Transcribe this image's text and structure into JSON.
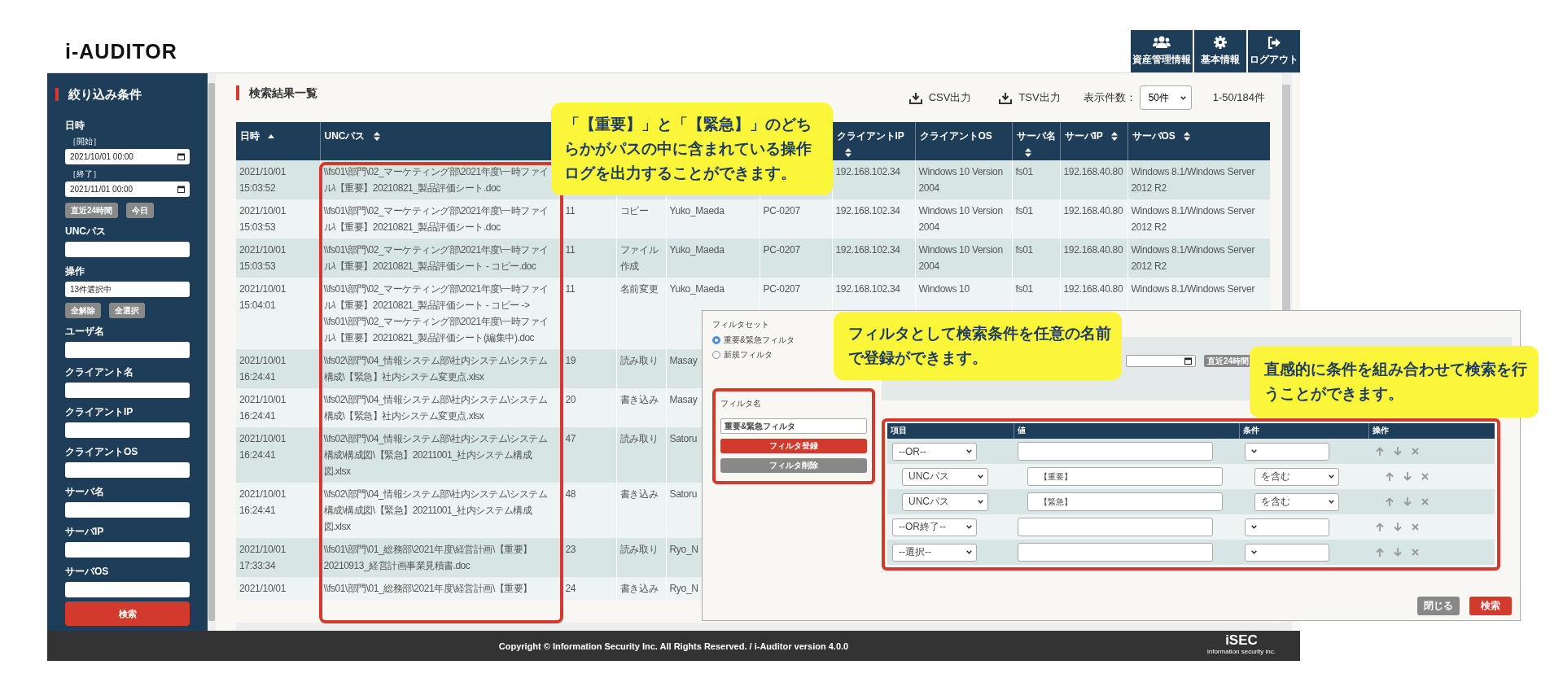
{
  "header": {
    "logo": "i-AUDITOR",
    "nav": [
      {
        "label": "資産管理情報",
        "kind": "users"
      },
      {
        "label": "基本情報",
        "kind": "gear"
      },
      {
        "label": "ログアウト",
        "kind": "logout"
      }
    ]
  },
  "sidebar": {
    "title": "絞り込み条件",
    "items": [
      {
        "kind": "label",
        "text": "日時"
      },
      {
        "kind": "sublabel",
        "text": "［開始］"
      },
      {
        "kind": "date",
        "value": "2021/10/01 00:00"
      },
      {
        "kind": "sublabel",
        "text": "［終了］"
      },
      {
        "kind": "date",
        "value": "2021/11/01 00:00"
      },
      {
        "kind": "buttons",
        "buttons": [
          "直近24時間",
          "今日"
        ]
      },
      {
        "kind": "label",
        "text": "UNCパス"
      },
      {
        "kind": "input"
      },
      {
        "kind": "label",
        "text": "操作"
      },
      {
        "kind": "input",
        "value": "13件選択中"
      },
      {
        "kind": "buttons",
        "buttons": [
          "全解除",
          "全選択"
        ]
      },
      {
        "kind": "label",
        "text": "ユーザ名"
      },
      {
        "kind": "input"
      },
      {
        "kind": "label",
        "text": "クライアント名"
      },
      {
        "kind": "input"
      },
      {
        "kind": "label",
        "text": "クライアントIP"
      },
      {
        "kind": "input"
      },
      {
        "kind": "label",
        "text": "クライアントOS"
      },
      {
        "kind": "input"
      },
      {
        "kind": "label",
        "text": "サーバ名"
      },
      {
        "kind": "input"
      },
      {
        "kind": "label",
        "text": "サーバIP"
      },
      {
        "kind": "input"
      },
      {
        "kind": "label",
        "text": "サーバOS"
      },
      {
        "kind": "input"
      }
    ],
    "search_button": "検索"
  },
  "results": {
    "title": "検索結果一覧",
    "exports": [
      "CSV出力",
      "TSV出力"
    ],
    "page_size_label": "表示件数：",
    "page_size": "50件",
    "range": "1-50/184件",
    "table": {
      "columns": [
        {
          "label": "日時",
          "kind": "sortable",
          "sorted": true
        },
        {
          "label": "UNCパス",
          "kind": "sortable",
          "sorted": false
        },
        null,
        null,
        null,
        null,
        {
          "label": "クライアントIP",
          "kind": "sortable",
          "sorted": false
        },
        {
          "label": "クライアントOS",
          "kind": "plain"
        },
        {
          "label": "サーバ名",
          "kind": "sortable",
          "sorted": false
        },
        {
          "label": "サーバIP",
          "kind": "sortable",
          "sorted": false
        },
        {
          "label": "サーバOS",
          "kind": "sortable",
          "sorted": false
        }
      ],
      "rows": [
        {
          "cells": [
            "2021/10/01 15:03:52",
            "\\\\fs01\\部門\\02_マーケティング部\\2021年度\\一時ファイル\\【重要】20210821_製品評価シート.doc",
            null,
            null,
            null,
            null,
            "192.168.102.34",
            "Windows 10 Version 2004",
            "fs01",
            "192.168.40.80",
            "Windows 8.1/Windows Server 2012 R2"
          ]
        },
        {
          "cells": [
            "2021/10/01 15:03:53",
            "\\\\fs01\\部門\\02_マーケティング部\\2021年度\\一時ファイル\\【重要】20210821_製品評価シート.doc",
            "11",
            "コピー",
            "Yuko_Maeda",
            "PC-0207",
            "192.168.102.34",
            "Windows 10 Version 2004",
            "fs01",
            "192.168.40.80",
            "Windows 8.1/Windows Server 2012 R2"
          ]
        },
        {
          "cells": [
            "2021/10/01 15:03:53",
            "\\\\fs01\\部門\\02_マーケティング部\\2021年度\\一時ファイル\\【重要】20210821_製品評価シート - コピー.doc",
            "11",
            "ファイル作成",
            "Yuko_Maeda",
            "PC-0207",
            "192.168.102.34",
            "Windows 10 Version 2004",
            "fs01",
            "192.168.40.80",
            "Windows 8.1/Windows Server 2012 R2"
          ]
        },
        {
          "cells": [
            "2021/10/01 15:04:01",
            "\\\\fs01\\部門\\02_マーケティング部\\2021年度\\一時ファイル\\【重要】20210821_製品評価シート - コピー -> \\\\fs01\\部門\\02_マーケティング部\\2021年度\\一時ファイル\\【重要】20210821_製品評価シート(編集中).doc",
            "11",
            "名前変更",
            "Yuko_Maeda",
            "PC-0207",
            "192.168.102.34",
            "Windows 10",
            "fs01",
            "192.168.40.80",
            "Windows 8.1/Windows Server"
          ]
        },
        {
          "cells": [
            "2021/10/01 16:24:41",
            "\\\\fs02\\部門\\04_情報システム部\\社内システム\\システム構成\\【緊急】社内システム変更点.xlsx",
            "19",
            "読み取り",
            "Masay",
            null,
            null,
            null,
            null,
            null,
            null
          ]
        },
        {
          "cells": [
            "2021/10/01 16:24:41",
            "\\\\fs02\\部門\\04_情報システム部\\社内システム\\システム構成\\【緊急】社内システム変更点.xlsx",
            "20",
            "書き込み",
            "Masay",
            null,
            null,
            null,
            null,
            null,
            null
          ]
        },
        {
          "cells": [
            "2021/10/01 16:24:41",
            "\\\\fs02\\部門\\04_情報システム部\\社内システム\\システム構成\\構成図\\【緊急】20211001_社内システム構成図.xlsx",
            "47",
            "読み取り",
            "Satoru",
            null,
            null,
            null,
            null,
            null,
            null
          ]
        },
        {
          "cells": [
            "2021/10/01 16:24:41",
            "\\\\fs02\\部門\\04_情報システム部\\社内システム\\システム構成\\構成図\\【緊急】20211001_社内システム構成図.xlsx",
            "48",
            "書き込み",
            "Satoru",
            null,
            null,
            null,
            null,
            null,
            null
          ]
        },
        {
          "cells": [
            "2021/10/01 17:33:34",
            "\\\\fs01\\部門\\01_総務部\\2021年度\\経営計画\\【重要】20210913_経営計画事業見積書.doc",
            "23",
            "読み取り",
            "Ryo_N",
            null,
            null,
            null,
            null,
            null,
            null
          ]
        },
        {
          "cells": [
            "2021/10/01",
            "\\\\fs01\\部門\\01_総務部\\2021年度\\経営計画\\【重要】",
            "24",
            "書き込み",
            "Ryo_N",
            null,
            null,
            null,
            null,
            null,
            null
          ]
        }
      ]
    }
  },
  "modal": {
    "filter_set_label": "フィルタセット",
    "filter_sets": [
      {
        "label": "重要&緊急フィルタ",
        "selected": true
      },
      {
        "label": "新規フィルタ",
        "selected": false
      }
    ],
    "filter_name_label": "フィルタ名",
    "filter_name": "重要&緊急フィルタ",
    "register_button": "フィルタ登録",
    "delete_button": "フィルタ削除",
    "quick_button": "直近24時間",
    "conditions": {
      "columns": [
        "項目",
        "値",
        "条件",
        "操作"
      ],
      "rows": [
        {
          "item": "--OR--",
          "children": [
            {
              "item": "UNCパス",
              "value": "【重要】",
              "condition": "を含む"
            },
            {
              "item": "UNCパス",
              "value": "【緊急】",
              "condition": "を含む"
            }
          ]
        },
        {
          "item": "--OR終了--"
        },
        {
          "item": "--選択--"
        }
      ]
    },
    "buttons": [
      {
        "label": "閉じる",
        "kind": "secondary"
      },
      {
        "label": "検索",
        "kind": "primary"
      }
    ]
  },
  "callouts": [
    {
      "text": "「【重要】」と「【緊急】」のどちらかがパスの中に含まれている操作ログを出力することができます。"
    },
    {
      "text": "フィルタとして検索条件を任意の名前で登録ができます。"
    },
    {
      "text": "直感的に条件を組み合わせて検索を行うことができます。"
    }
  ],
  "footer": {
    "copyright": "Copyright © Information Security Inc. All Rights Reserved. / i-Auditor version 4.0.0",
    "logo": "iSEC",
    "tagline": "information security inc."
  }
}
